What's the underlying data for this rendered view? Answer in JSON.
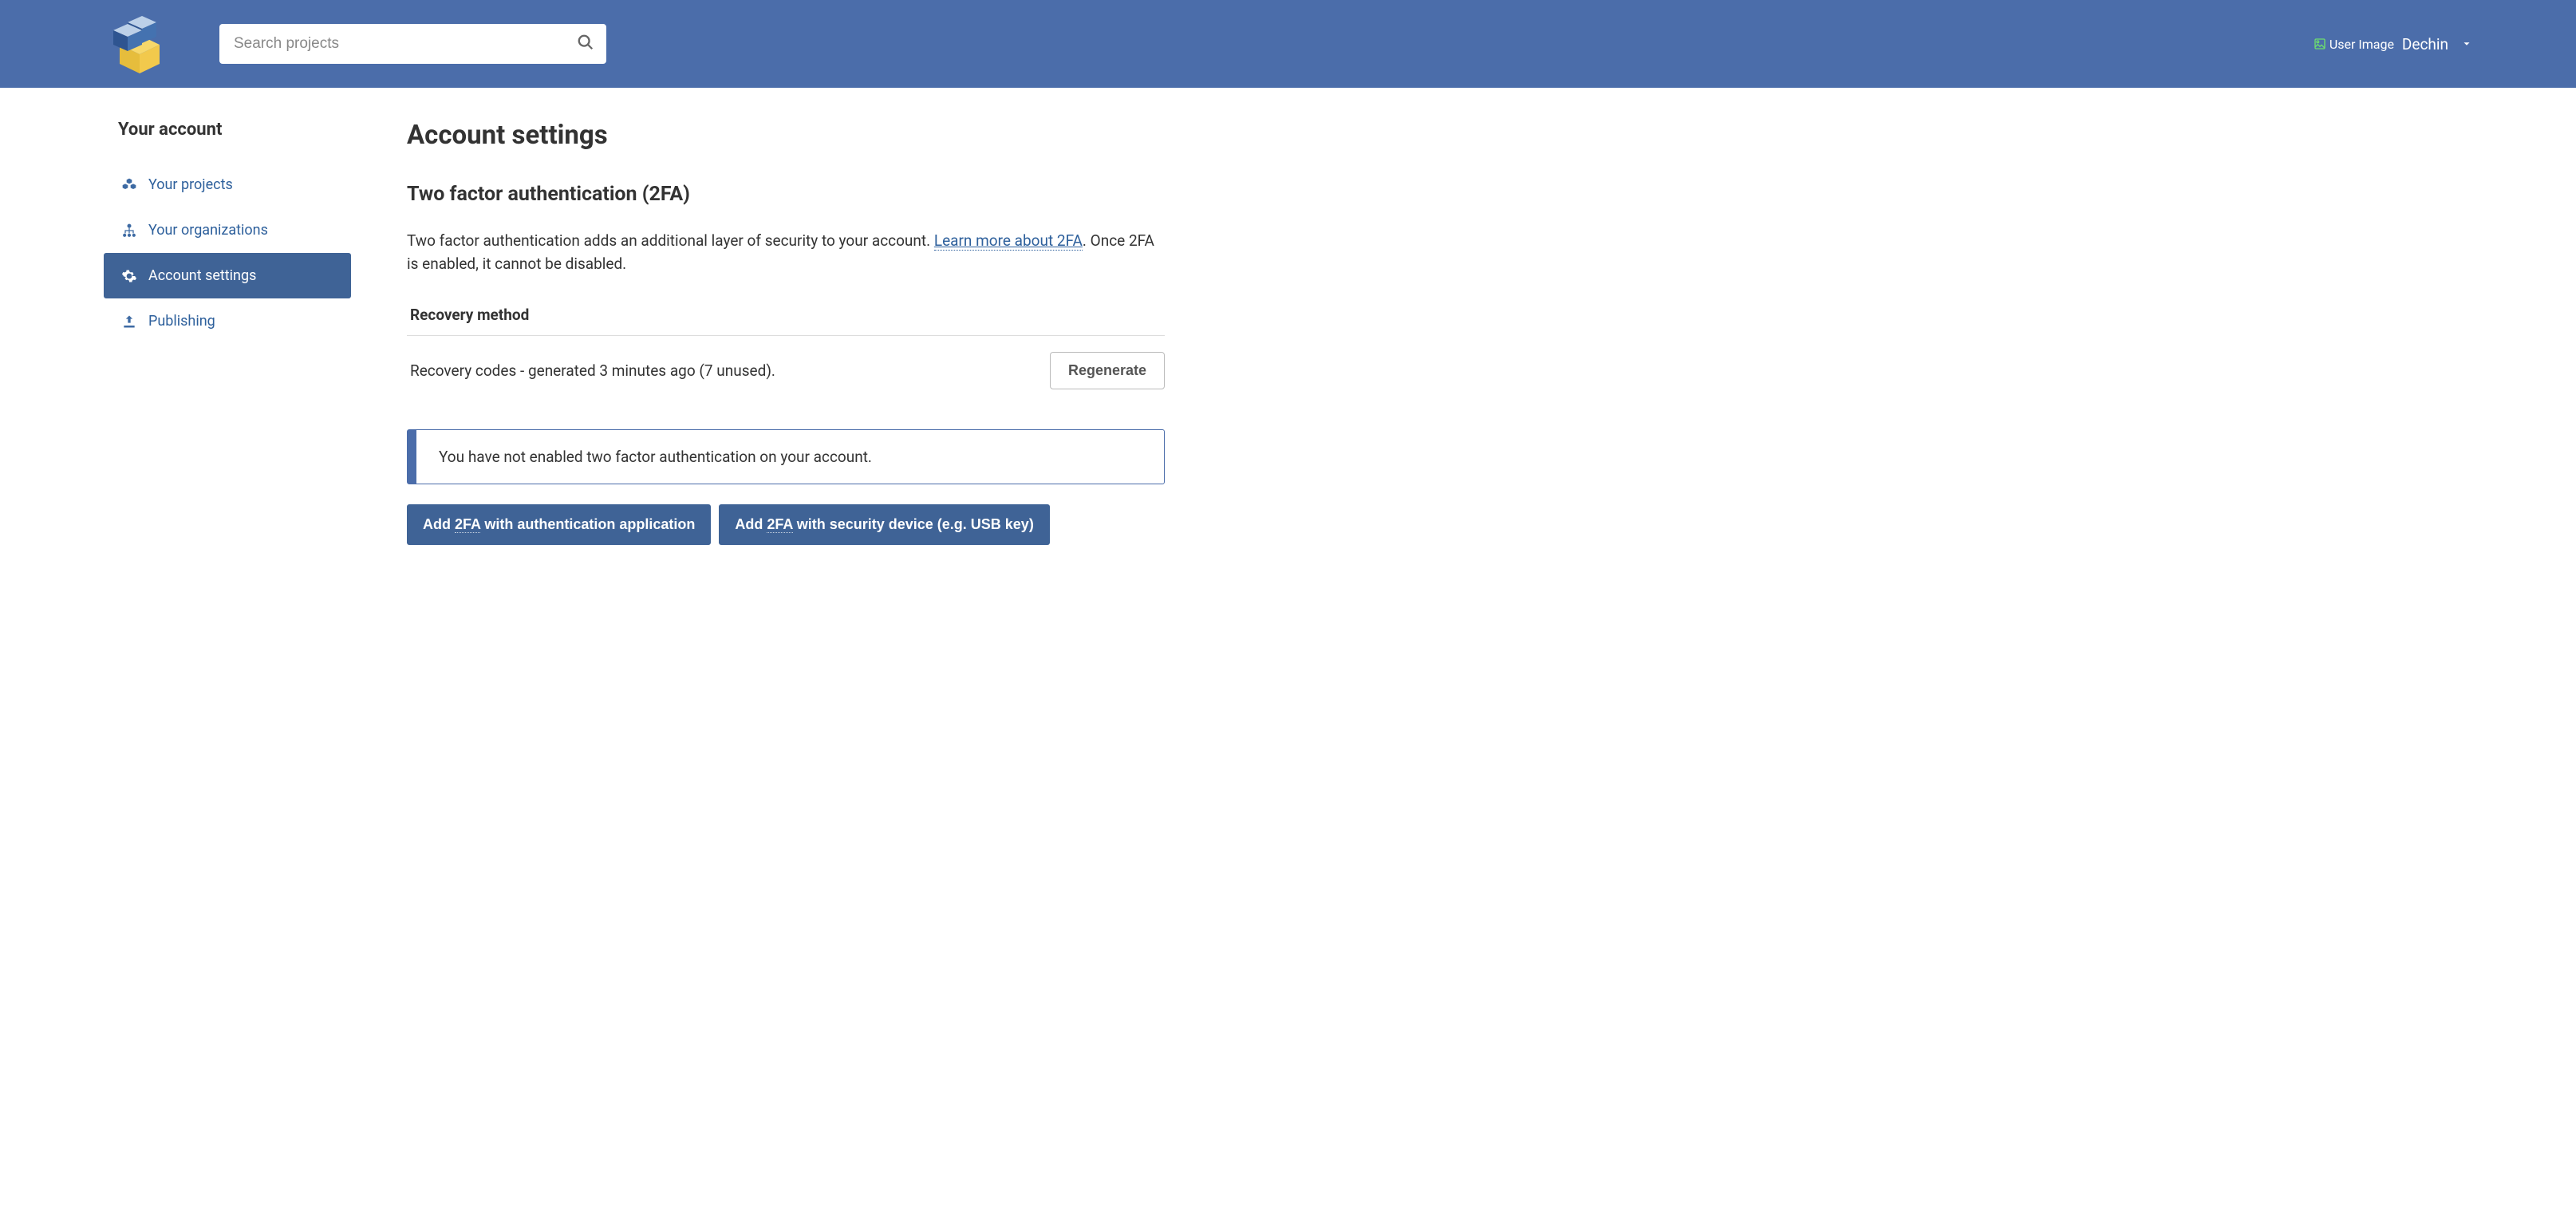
{
  "header": {
    "search_placeholder": "Search projects",
    "user_image_alt": "User Image",
    "username": "Dechin"
  },
  "sidebar": {
    "title": "Your account",
    "items": [
      {
        "label": "Your projects",
        "icon": "boxes-icon"
      },
      {
        "label": "Your organizations",
        "icon": "sitemap-icon"
      },
      {
        "label": "Account settings",
        "icon": "gear-icon"
      },
      {
        "label": "Publishing",
        "icon": "upload-icon"
      }
    ]
  },
  "main": {
    "title": "Account settings",
    "section_title": "Two factor authentication (2FA)",
    "desc_part1": "Two factor authentication adds an additional layer of security to your account. ",
    "desc_link": "Learn more about 2FA",
    "desc_part2": ". Once 2FA is enabled, it cannot be disabled.",
    "recovery_heading": "Recovery method",
    "recovery_text": "Recovery codes - generated 3 minutes ago (7 unused).",
    "regenerate_label": "Regenerate",
    "alert_text": "You have not enabled two factor authentication on your account.",
    "btn_app_prefix": "Add ",
    "btn_app_abbr": "2FA",
    "btn_app_suffix": " with authentication application",
    "btn_device_prefix": "Add ",
    "btn_device_abbr": "2FA",
    "btn_device_suffix": " with security device (e.g. USB key)"
  }
}
